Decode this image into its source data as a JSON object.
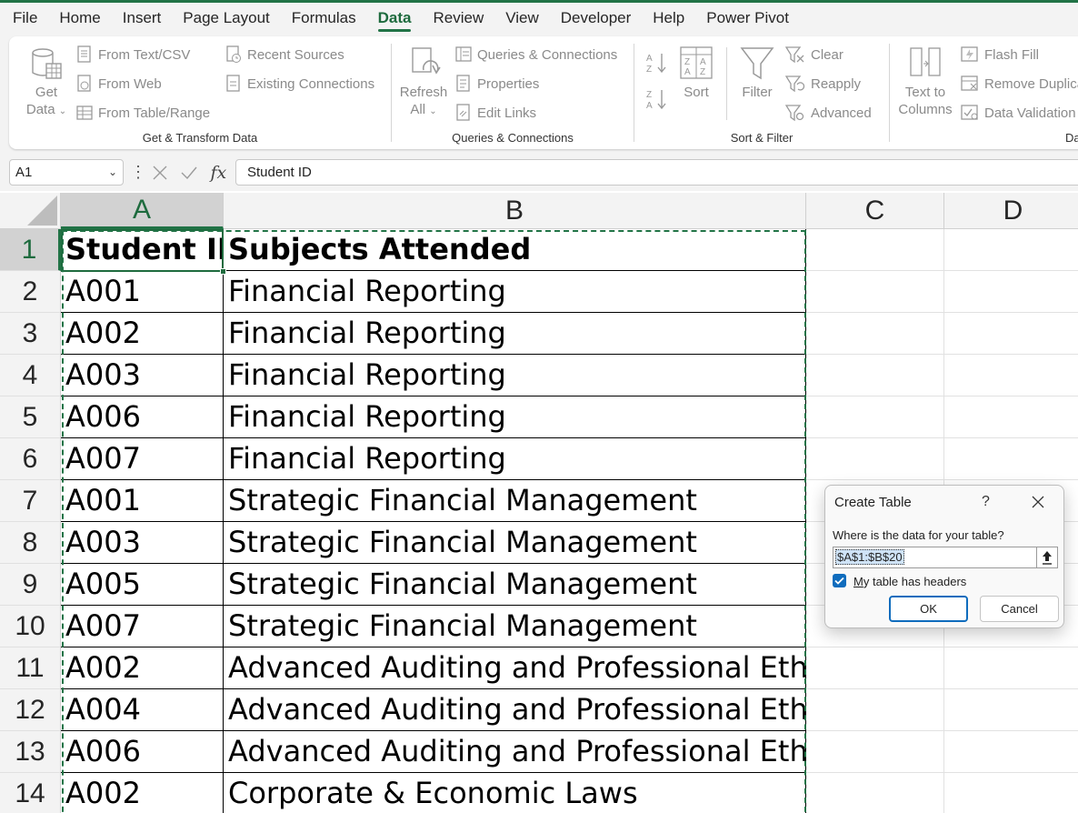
{
  "menu": [
    "File",
    "Home",
    "Insert",
    "Page Layout",
    "Formulas",
    "Data",
    "Review",
    "View",
    "Developer",
    "Help",
    "Power Pivot"
  ],
  "active_menu": "Data",
  "ribbon": {
    "get_data": {
      "line1": "Get",
      "line2": "Data"
    },
    "from_text_csv": "From Text/CSV",
    "from_web": "From Web",
    "from_table_range": "From Table/Range",
    "recent_sources": "Recent Sources",
    "existing_connections": "Existing Connections",
    "group_get_transform": "Get & Transform Data",
    "refresh_all": {
      "line1": "Refresh",
      "line2": "All"
    },
    "queries_connections": "Queries & Connections",
    "properties": "Properties",
    "edit_links": "Edit Links",
    "group_queries": "Queries & Connections",
    "sort": "Sort",
    "filter": "Filter",
    "clear": "Clear",
    "reapply": "Reapply",
    "advanced": "Advanced",
    "group_sort_filter": "Sort & Filter",
    "text_to_columns": {
      "line1": "Text to",
      "line2": "Columns"
    },
    "flash_fill": "Flash Fill",
    "remove_duplicates": "Remove Duplica",
    "data_validation": "Data Validation",
    "group_data_tools": "Data"
  },
  "formula_bar": {
    "name_box": "A1",
    "fx": "fx",
    "content": "Student ID"
  },
  "columns": [
    "A",
    "B",
    "C",
    "D"
  ],
  "rows": [
    {
      "num": "1",
      "a": "Student ID",
      "b": "Subjects Attended"
    },
    {
      "num": "2",
      "a": "A001",
      "b": "Financial Reporting"
    },
    {
      "num": "3",
      "a": "A002",
      "b": "Financial Reporting"
    },
    {
      "num": "4",
      "a": "A003",
      "b": "Financial Reporting"
    },
    {
      "num": "5",
      "a": "A006",
      "b": "Financial Reporting"
    },
    {
      "num": "6",
      "a": "A007",
      "b": "Financial Reporting"
    },
    {
      "num": "7",
      "a": "A001",
      "b": "Strategic Financial Management"
    },
    {
      "num": "8",
      "a": "A003",
      "b": "Strategic Financial Management"
    },
    {
      "num": "9",
      "a": "A005",
      "b": "Strategic Financial Management"
    },
    {
      "num": "10",
      "a": "A007",
      "b": "Strategic Financial Management"
    },
    {
      "num": "11",
      "a": "A002",
      "b": "Advanced Auditing and Professional Ethics"
    },
    {
      "num": "12",
      "a": "A004",
      "b": "Advanced Auditing and Professional Ethics"
    },
    {
      "num": "13",
      "a": "A006",
      "b": "Advanced Auditing and Professional Ethics"
    },
    {
      "num": "14",
      "a": "A002",
      "b": "Corporate & Economic Laws"
    }
  ],
  "dialog": {
    "title": "Create Table",
    "help": "?",
    "question": "Where is the data for your table?",
    "range": "$A$1:$B$20",
    "headers_label_first": "M",
    "headers_label_rest": "y table has headers",
    "headers_checked": true,
    "ok": "OK",
    "cancel": "Cancel"
  },
  "colors": {
    "accent": "#217346",
    "dialog_blue": "#0f6cbd"
  }
}
